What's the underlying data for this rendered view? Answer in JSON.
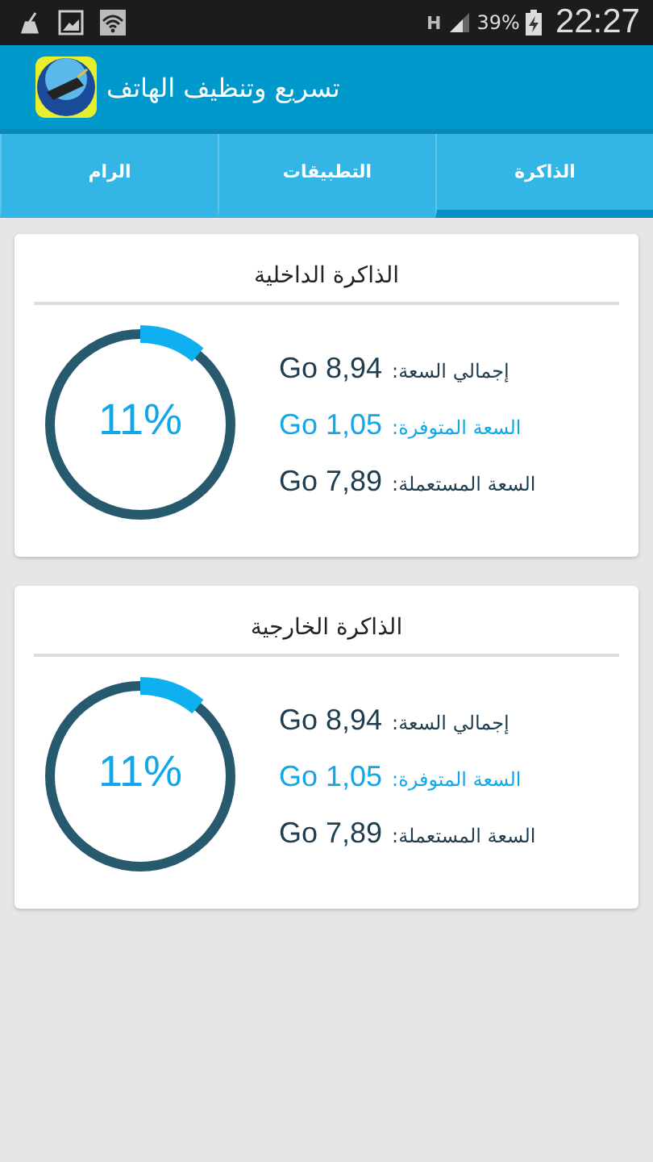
{
  "status_bar": {
    "battery": "39%",
    "time": "22:27",
    "network": "H"
  },
  "app_bar": {
    "title": "تسريع وتنظيف الهاتف"
  },
  "tabs": [
    {
      "label": "الذاكرة",
      "selected": true
    },
    {
      "label": "التطبيقات",
      "selected": false
    },
    {
      "label": "الرام",
      "selected": false
    }
  ],
  "cards": [
    {
      "title": "الذاكرة الداخلية",
      "percent": "11%",
      "rows": [
        {
          "kind": "total",
          "label": "إجمالي السعة:",
          "value": "Go 8,94"
        },
        {
          "kind": "free",
          "label": "السعة المتوفرة:",
          "value": "Go 1,05"
        },
        {
          "kind": "used",
          "label": "السعة المستعملة:",
          "value": "Go 7,89"
        }
      ]
    },
    {
      "title": "الذاكرة الخارجية",
      "percent": "11%",
      "rows": [
        {
          "kind": "total",
          "label": "إجمالي السعة:",
          "value": "Go 8,94"
        },
        {
          "kind": "free",
          "label": "السعة المتوفرة:",
          "value": "Go 1,05"
        },
        {
          "kind": "used",
          "label": "السعة المستعملة:",
          "value": "Go 7,89"
        }
      ]
    }
  ]
}
